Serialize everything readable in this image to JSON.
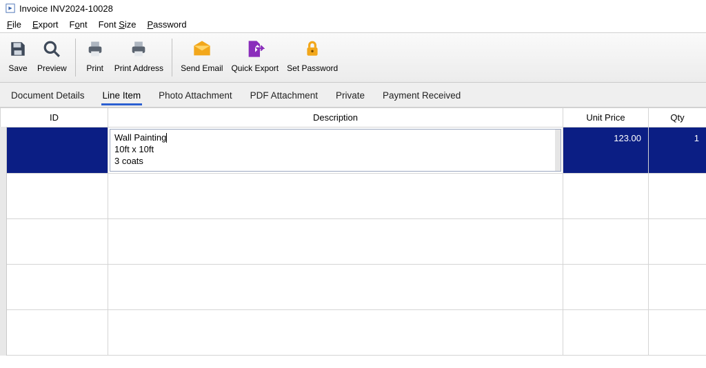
{
  "window": {
    "title": "Invoice INV2024-10028"
  },
  "menubar": [
    {
      "pre": "",
      "u": "F",
      "post": "ile"
    },
    {
      "pre": "",
      "u": "E",
      "post": "xport"
    },
    {
      "pre": "F",
      "u": "o",
      "post": "nt"
    },
    {
      "pre": "Font ",
      "u": "S",
      "post": "ize"
    },
    {
      "pre": "",
      "u": "P",
      "post": "assword"
    }
  ],
  "toolbar": {
    "save": "Save",
    "preview": "Preview",
    "print": "Print",
    "print_address": "Print Address",
    "send_email": "Send Email",
    "quick_export": "Quick Export",
    "set_password": "Set Password"
  },
  "tabs": {
    "document_details": "Document Details",
    "line_item": "Line Item",
    "photo_attachment": "Photo Attachment",
    "pdf_attachment": "PDF Attachment",
    "private": "Private",
    "payment_received": "Payment Received",
    "active": "line_item"
  },
  "columns": {
    "id": "ID",
    "description": "Description",
    "unit_price": "Unit Price",
    "qty": "Qty"
  },
  "rows": [
    {
      "id": "",
      "description": "Wall Painting\n10ft x 10ft\n3 coats",
      "desc_line1": "Wall Painting",
      "desc_line2": "10ft x 10ft",
      "desc_line3": "3 coats",
      "unit_price": "123.00",
      "qty": "1",
      "selected": true,
      "editing": true
    },
    {
      "id": "",
      "description": "",
      "unit_price": "",
      "qty": "",
      "selected": false,
      "editing": false
    },
    {
      "id": "",
      "description": "",
      "unit_price": "",
      "qty": "",
      "selected": false,
      "editing": false
    },
    {
      "id": "",
      "description": "",
      "unit_price": "",
      "qty": "",
      "selected": false,
      "editing": false
    },
    {
      "id": "",
      "description": "",
      "unit_price": "",
      "qty": "",
      "selected": false,
      "editing": false
    }
  ]
}
